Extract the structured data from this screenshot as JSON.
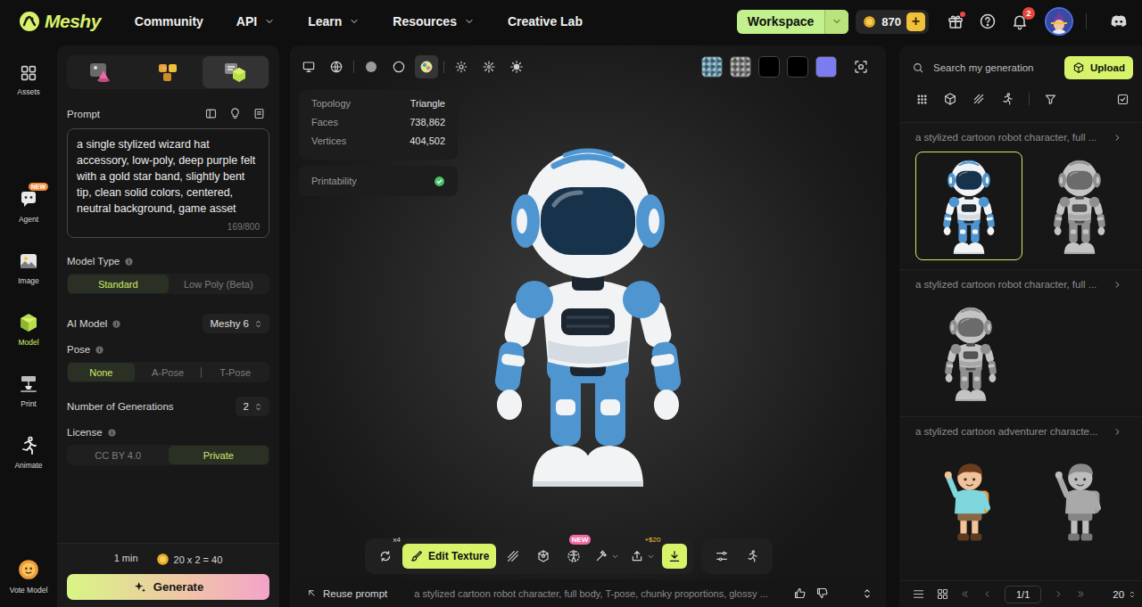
{
  "nav": {
    "logo": "Meshy",
    "links": [
      {
        "label": "Community",
        "dropdown": false
      },
      {
        "label": "API",
        "dropdown": true
      },
      {
        "label": "Learn",
        "dropdown": true
      },
      {
        "label": "Resources",
        "dropdown": true
      },
      {
        "label": "Creative Lab",
        "dropdown": false
      }
    ],
    "workspace": "Workspace",
    "credits": "870",
    "credits_add": "+",
    "gift_dot": true,
    "notification_count": "2"
  },
  "rail": [
    {
      "label": "Assets",
      "selected": false
    },
    {
      "label": "Agent",
      "selected": false,
      "badge": "NEW"
    },
    {
      "label": "Image",
      "selected": false
    },
    {
      "label": "Model",
      "selected": true
    },
    {
      "label": "Print",
      "selected": false
    },
    {
      "label": "Animate",
      "selected": false
    },
    {
      "label": "Vote Model",
      "selected": false
    }
  ],
  "mode_tabs": [
    {
      "selected": false
    },
    {
      "selected": false
    },
    {
      "selected": true
    }
  ],
  "prompt": {
    "label": "Prompt",
    "text": "a single stylized wizard hat accessory, low-poly, deep purple felt with a gold star band, slightly bent tip, clean solid colors, centered, neutral background, game asset",
    "counter": "169/800"
  },
  "model_type": {
    "label": "Model Type",
    "options": [
      {
        "label": "Standard",
        "selected": true
      },
      {
        "label": "Low Poly (Beta)",
        "selected": false
      }
    ]
  },
  "ai_model": {
    "label": "AI Model",
    "value": "Meshy 6"
  },
  "pose": {
    "label": "Pose",
    "options": [
      {
        "label": "None",
        "selected": true
      },
      {
        "label": "A-Pose",
        "selected": false
      },
      {
        "label": "T-Pose",
        "selected": false
      }
    ]
  },
  "generations": {
    "label": "Number of Generations",
    "value": "2"
  },
  "license": {
    "label": "License",
    "options": [
      {
        "label": "CC BY 4.0",
        "selected": false
      },
      {
        "label": "Private",
        "selected": true
      }
    ]
  },
  "footer": {
    "time": "1 min",
    "cost": "20 x 2 = 40",
    "generate": "Generate"
  },
  "viewport": {
    "tools": [
      {
        "selected": false
      },
      {
        "selected": false
      },
      {
        "selected": false
      },
      {
        "selected": false
      },
      {
        "selected": true
      },
      {
        "selected": false
      },
      {
        "selected": false
      },
      {
        "selected": false
      }
    ],
    "swatches": [
      {
        "kind": "texture",
        "color": "#5d8fa6"
      },
      {
        "kind": "texture",
        "color": "#7a7a7a"
      },
      {
        "kind": "solid",
        "color": "#000000"
      },
      {
        "kind": "solid",
        "color": "#000000"
      },
      {
        "kind": "solid",
        "color": "#7b7cf0"
      }
    ],
    "stats": [
      {
        "label": "Topology",
        "value": "Triangle"
      },
      {
        "label": "Faces",
        "value": "738,862"
      },
      {
        "label": "Vertices",
        "value": "404,502"
      }
    ],
    "printability": {
      "label": "Printability",
      "ok": true
    },
    "actions": [
      {
        "kind": "icon",
        "badge": "x4"
      },
      {
        "kind": "button",
        "label": "Edit Texture",
        "selected": true
      },
      {
        "kind": "icon"
      },
      {
        "kind": "icon"
      },
      {
        "kind": "icon",
        "badge": "NEW"
      },
      {
        "kind": "icon",
        "dropdown": true
      },
      {
        "kind": "icon",
        "badge": "+$20",
        "dropdown": true
      },
      {
        "kind": "icon",
        "highlighted": true
      }
    ],
    "actions_extra": [
      {
        "kind": "icon"
      },
      {
        "kind": "icon"
      }
    ],
    "reuse": "Reuse prompt",
    "prompt_preview": "a stylized cartoon robot character, full body, T-pose, chunky proportions, glossy ..."
  },
  "history": {
    "search_placeholder": "Search my generation",
    "upload": "Upload",
    "groups": [
      {
        "title": "a stylized cartoon robot character, full ...",
        "items": [
          {
            "kind": "robot",
            "textured": true,
            "selected": true
          },
          {
            "kind": "robot",
            "textured": false,
            "selected": false
          }
        ]
      },
      {
        "title": "a stylized cartoon robot character, full ...",
        "items": [
          {
            "kind": "robot",
            "textured": false,
            "selected": false
          }
        ]
      },
      {
        "title": "a stylized cartoon adventurer characte...",
        "items": [
          {
            "kind": "adventurer",
            "textured": true,
            "selected": false
          },
          {
            "kind": "adventurer",
            "textured": false,
            "selected": false
          }
        ]
      }
    ],
    "page": "1/1",
    "page_size": "20"
  }
}
